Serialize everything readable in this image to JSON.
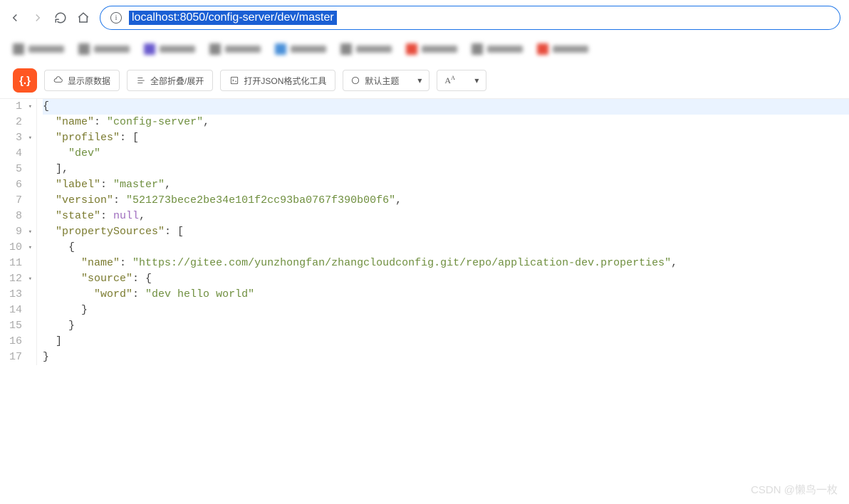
{
  "browser": {
    "url": "localhost:8050/config-server/dev/master"
  },
  "toolbar": {
    "logo": "{.}",
    "raw_data": "显示原数据",
    "collapse_expand": "全部折叠/展开",
    "open_formatter": "打开JSON格式化工具",
    "theme": "默认主题",
    "font_label": "A"
  },
  "json_lines": [
    {
      "num": 1,
      "fold": true,
      "indent": 0,
      "hl": true,
      "tokens": [
        [
          "p",
          "{"
        ]
      ]
    },
    {
      "num": 2,
      "fold": false,
      "indent": 1,
      "tokens": [
        [
          "k",
          "\"name\""
        ],
        [
          "p",
          ": "
        ],
        [
          "s",
          "\"config-server\""
        ],
        [
          "p",
          ","
        ]
      ]
    },
    {
      "num": 3,
      "fold": true,
      "indent": 1,
      "tokens": [
        [
          "k",
          "\"profiles\""
        ],
        [
          "p",
          ": ["
        ]
      ]
    },
    {
      "num": 4,
      "fold": false,
      "indent": 2,
      "tokens": [
        [
          "s",
          "\"dev\""
        ]
      ]
    },
    {
      "num": 5,
      "fold": false,
      "indent": 1,
      "tokens": [
        [
          "p",
          "],"
        ]
      ]
    },
    {
      "num": 6,
      "fold": false,
      "indent": 1,
      "tokens": [
        [
          "k",
          "\"label\""
        ],
        [
          "p",
          ": "
        ],
        [
          "s",
          "\"master\""
        ],
        [
          "p",
          ","
        ]
      ]
    },
    {
      "num": 7,
      "fold": false,
      "indent": 1,
      "tokens": [
        [
          "k",
          "\"version\""
        ],
        [
          "p",
          ": "
        ],
        [
          "s",
          "\"521273bece2be34e101f2cc93ba0767f390b00f6\""
        ],
        [
          "p",
          ","
        ]
      ]
    },
    {
      "num": 8,
      "fold": false,
      "indent": 1,
      "tokens": [
        [
          "k",
          "\"state\""
        ],
        [
          "p",
          ": "
        ],
        [
          "n",
          "null"
        ],
        [
          "p",
          ","
        ]
      ]
    },
    {
      "num": 9,
      "fold": true,
      "indent": 1,
      "tokens": [
        [
          "k",
          "\"propertySources\""
        ],
        [
          "p",
          ": ["
        ]
      ]
    },
    {
      "num": 10,
      "fold": true,
      "indent": 2,
      "tokens": [
        [
          "p",
          "{"
        ]
      ]
    },
    {
      "num": 11,
      "fold": false,
      "indent": 3,
      "tokens": [
        [
          "k",
          "\"name\""
        ],
        [
          "p",
          ": "
        ],
        [
          "s",
          "\"https://gitee.com/yunzhongfan/zhangcloudconfig.git/repo/application-dev.properties\""
        ],
        [
          "p",
          ","
        ]
      ]
    },
    {
      "num": 12,
      "fold": true,
      "indent": 3,
      "tokens": [
        [
          "k",
          "\"source\""
        ],
        [
          "p",
          ": {"
        ]
      ]
    },
    {
      "num": 13,
      "fold": false,
      "indent": 4,
      "tokens": [
        [
          "k",
          "\"word\""
        ],
        [
          "p",
          ": "
        ],
        [
          "s",
          "\"dev hello world\""
        ]
      ]
    },
    {
      "num": 14,
      "fold": false,
      "indent": 3,
      "tokens": [
        [
          "p",
          "}"
        ]
      ]
    },
    {
      "num": 15,
      "fold": false,
      "indent": 2,
      "tokens": [
        [
          "p",
          "}"
        ]
      ]
    },
    {
      "num": 16,
      "fold": false,
      "indent": 1,
      "tokens": [
        [
          "p",
          "]"
        ]
      ]
    },
    {
      "num": 17,
      "fold": false,
      "indent": 0,
      "tokens": [
        [
          "p",
          "}"
        ]
      ]
    }
  ],
  "watermark": "CSDN @懒鸟一枚"
}
